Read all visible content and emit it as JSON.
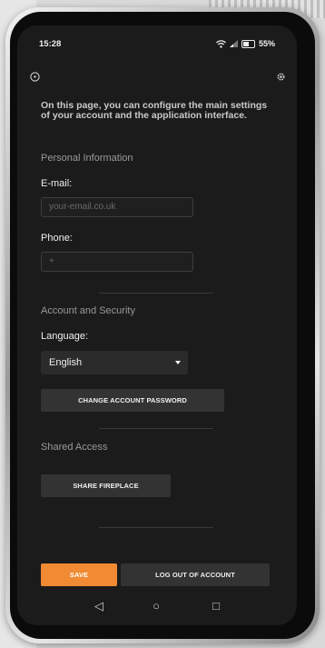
{
  "status_bar": {
    "time": "15:28",
    "battery": "55%"
  },
  "header": {
    "left_icon": "info-circle-icon",
    "right_icon": "gear-icon"
  },
  "intro_text": "On this page, you can configure the main settings of your account and the application interface.",
  "personal_info": {
    "title": "Personal Information",
    "email_label": "E-mail:",
    "email_placeholder": "your-email.co.uk",
    "phone_label": "Phone:",
    "phone_placeholder": "+"
  },
  "account_security": {
    "title": "Account and Security",
    "language_label": "Language:",
    "language_value": "English",
    "change_password_label": "CHANGE ACCOUNT PASSWORD"
  },
  "shared_access": {
    "title": "Shared Access",
    "share_label": "SHARE FIREPLACE"
  },
  "footer": {
    "save_label": "SAVE",
    "logout_label": "LOG OUT OF ACCOUNT"
  },
  "nav": {
    "back": "◁",
    "home": "○",
    "recents": "□"
  },
  "colors": {
    "accent": "#f08a33",
    "screen_bg": "#1b1b1b"
  }
}
